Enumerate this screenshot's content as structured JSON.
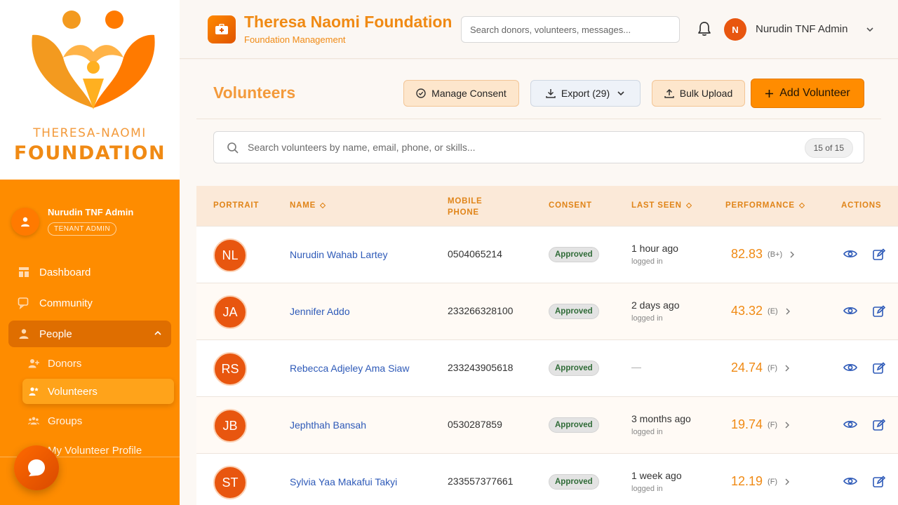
{
  "brand": {
    "logo_line1": "THERESA-NAOMI",
    "logo_line2": "FOUNDATION"
  },
  "sidebar": {
    "user_name": "Nurudin TNF Admin",
    "user_role": "TENANT ADMIN",
    "items": [
      {
        "label": "Dashboard",
        "icon": "dashboard-icon"
      },
      {
        "label": "Community",
        "icon": "chat-icon"
      },
      {
        "label": "People",
        "icon": "person-icon",
        "expanded": true
      }
    ],
    "subitems": [
      {
        "label": "Donors",
        "icon": "donor-icon"
      },
      {
        "label": "Volunteers",
        "icon": "volunteer-icon",
        "active": true
      },
      {
        "label": "Groups",
        "icon": "groups-icon"
      },
      {
        "label": "My Volunteer Profile",
        "icon": "profile-icon"
      }
    ]
  },
  "header": {
    "title": "Theresa Naomi Foundation",
    "subtitle": "Foundation Management",
    "search_placeholder": "Search donors, volunteers, messages...",
    "avatar_initial": "N",
    "user_name": "Nurudin TNF Admin"
  },
  "page": {
    "title": "Volunteers",
    "buttons": {
      "consent": "Manage Consent",
      "export": "Export (29)",
      "bulk": "Bulk Upload",
      "add": "Add Volunteer"
    },
    "search_placeholder": "Search volunteers by name, email, phone, or skills...",
    "count": "15 of 15"
  },
  "table": {
    "headers": {
      "portrait": "PORTRAIT",
      "name": "NAME",
      "phone_line1": "MOBILE",
      "phone_line2": "PHONE",
      "consent": "CONSENT",
      "last_seen": "LAST SEEN",
      "performance": "PERFORMANCE",
      "actions": "ACTIONS"
    },
    "rows": [
      {
        "initials": "NL",
        "name": "Nurudin Wahab Lartey",
        "phone": "0504065214",
        "consent": "Approved",
        "seen": "1 hour ago",
        "seen_sub": "logged in",
        "score": "82.83",
        "grade": "(B+)"
      },
      {
        "initials": "JA",
        "name": "Jennifer Addo",
        "phone": "233266328100",
        "consent": "Approved",
        "seen": "2 days ago",
        "seen_sub": "logged in",
        "score": "43.32",
        "grade": "(E)"
      },
      {
        "initials": "RS",
        "name": "Rebecca Adjeley Ama Siaw",
        "phone": "233243905618",
        "consent": "Approved",
        "seen": "—",
        "seen_sub": "",
        "score": "24.74",
        "grade": "(F)"
      },
      {
        "initials": "JB",
        "name": "Jephthah Bansah",
        "phone": "0530287859",
        "consent": "Approved",
        "seen": "3 months ago",
        "seen_sub": "logged in",
        "score": "19.74",
        "grade": "(F)"
      },
      {
        "initials": "ST",
        "name": "Sylvia Yaa Makafui Takyi",
        "phone": "233557377661",
        "consent": "Approved",
        "seen": "1 week ago",
        "seen_sub": "logged in",
        "score": "12.19",
        "grade": "(F)"
      }
    ]
  },
  "colors": {
    "brand_orange": "#fe8c00",
    "accent_orange": "#f08a14",
    "link_blue": "#2e5ab8",
    "avatar_orange": "#e8560f"
  }
}
